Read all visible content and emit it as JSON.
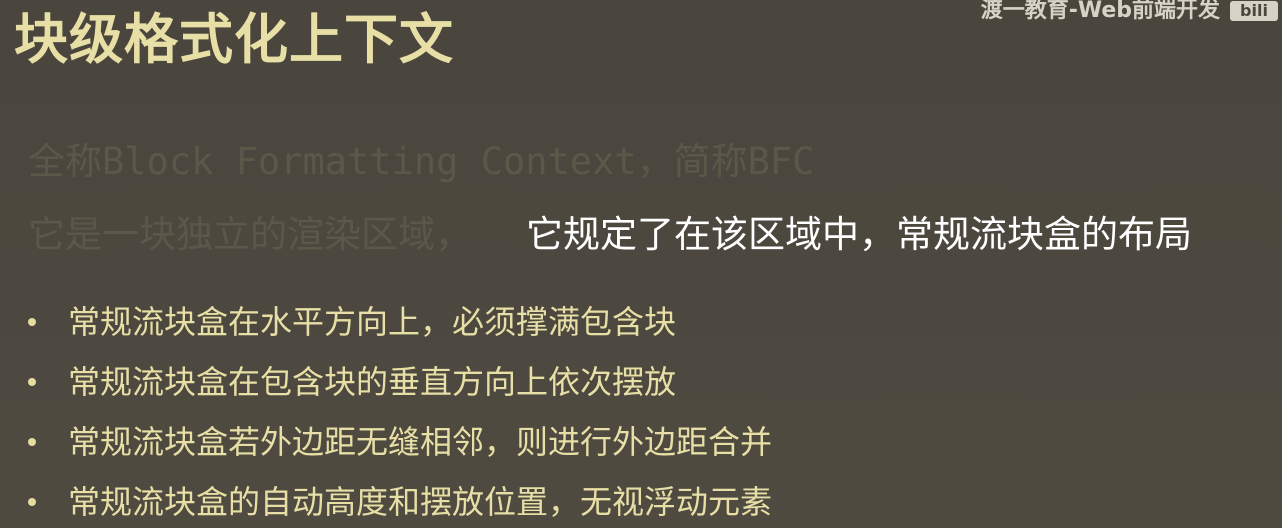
{
  "slide": {
    "title": "块级格式化上下文",
    "watermark": {
      "text": "渡一教育-Web前端开发",
      "logo_text": "bili"
    },
    "faded_line_1": "全称Block Formatting Context，简称BFC",
    "faded_line_2": "它是一块独立的渲染区域，",
    "highlight_text": "它规定了在该区域中，常规流块盒的布局",
    "bullets": [
      "常规流块盒在水平方向上，必须撑满包含块",
      "常规流块盒在包含块的垂直方向上依次摆放",
      "常规流块盒若外边距无缝相邻，则进行外边距合并",
      "常规流块盒的自动高度和摆放位置，无视浮动元素"
    ]
  },
  "colors": {
    "background": "#4b473e",
    "title": "#e8dfa6",
    "highlight": "#ffffff",
    "faded": "#5b5749",
    "bullet_text": "#e8dfa6"
  }
}
